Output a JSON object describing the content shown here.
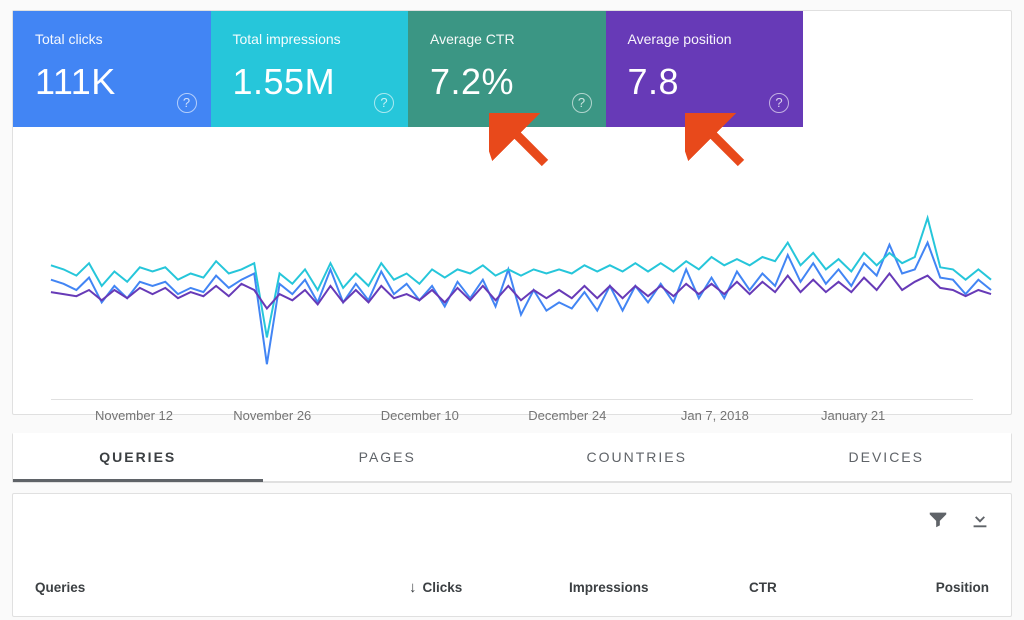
{
  "metrics": {
    "clicks": {
      "label": "Total clicks",
      "value": "111K"
    },
    "impressions": {
      "label": "Total impressions",
      "value": "1.55M"
    },
    "ctr": {
      "label": "Average CTR",
      "value": "7.2%"
    },
    "position": {
      "label": "Average position",
      "value": "7.8"
    }
  },
  "help_glyph": "?",
  "xaxis_labels": [
    "November 12",
    "November 26",
    "December 10",
    "December 24",
    "Jan 7, 2018",
    "January 21"
  ],
  "tabs": {
    "queries": "QUERIES",
    "pages": "PAGES",
    "countries": "COUNTRIES",
    "devices": "DEVICES"
  },
  "table": {
    "headers": {
      "queries": "Queries",
      "clicks": "Clicks",
      "impressions": "Impressions",
      "ctr": "CTR",
      "position": "Position"
    },
    "sort_indicator": "↓"
  },
  "colors": {
    "clicks": "#4285f4",
    "impressions": "#26c6da",
    "ctr": "#3b9684",
    "position": "#673ab7",
    "annotation_arrow": "#e8491b"
  },
  "chart_data": {
    "type": "line",
    "title": "",
    "xlabel": "",
    "ylabel": "",
    "x_ticks": [
      "November 12",
      "November 26",
      "December 10",
      "December 24",
      "Jan 7, 2018",
      "January 21"
    ],
    "series": [
      {
        "name": "Clicks",
        "color": "#4285f4",
        "values": [
          55,
          53,
          50,
          56,
          44,
          52,
          46,
          54,
          52,
          54,
          48,
          51,
          49,
          57,
          51,
          55,
          58,
          14,
          53,
          48,
          55,
          44,
          60,
          44,
          53,
          45,
          59,
          48,
          53,
          45,
          52,
          42,
          54,
          46,
          55,
          42,
          60,
          38,
          50,
          40,
          44,
          41,
          49,
          40,
          52,
          40,
          52,
          44,
          53,
          44,
          60,
          46,
          56,
          46,
          59,
          50,
          58,
          52,
          67,
          54,
          63,
          53,
          60,
          52,
          63,
          57,
          72,
          58,
          60,
          73,
          56,
          55,
          48,
          55,
          50
        ]
      },
      {
        "name": "Impressions",
        "color": "#26c6da",
        "values": [
          62,
          60,
          57,
          63,
          52,
          59,
          54,
          61,
          59,
          61,
          55,
          58,
          56,
          64,
          58,
          60,
          63,
          27,
          58,
          53,
          60,
          50,
          63,
          51,
          58,
          52,
          63,
          55,
          58,
          53,
          60,
          56,
          60,
          58,
          62,
          57,
          60,
          57,
          60,
          58,
          60,
          58,
          62,
          59,
          62,
          59,
          63,
          59,
          63,
          59,
          64,
          60,
          66,
          62,
          65,
          62,
          66,
          64,
          73,
          62,
          68,
          60,
          65,
          59,
          68,
          62,
          68,
          63,
          66,
          85,
          61,
          60,
          55,
          60,
          55
        ]
      },
      {
        "name": "Avg position",
        "color": "#673ab7",
        "values": [
          49,
          48,
          47,
          50,
          45,
          50,
          46,
          51,
          48,
          51,
          46,
          49,
          47,
          52,
          47,
          53,
          50,
          41,
          48,
          45,
          50,
          43,
          52,
          44,
          50,
          44,
          52,
          46,
          48,
          45,
          50,
          44,
          51,
          45,
          52,
          45,
          52,
          45,
          50,
          46,
          50,
          46,
          52,
          46,
          52,
          46,
          52,
          47,
          52,
          47,
          53,
          48,
          53,
          48,
          54,
          48,
          54,
          49,
          57,
          49,
          55,
          49,
          54,
          49,
          56,
          50,
          58,
          50,
          54,
          57,
          51,
          50,
          47,
          50,
          48
        ]
      }
    ]
  }
}
